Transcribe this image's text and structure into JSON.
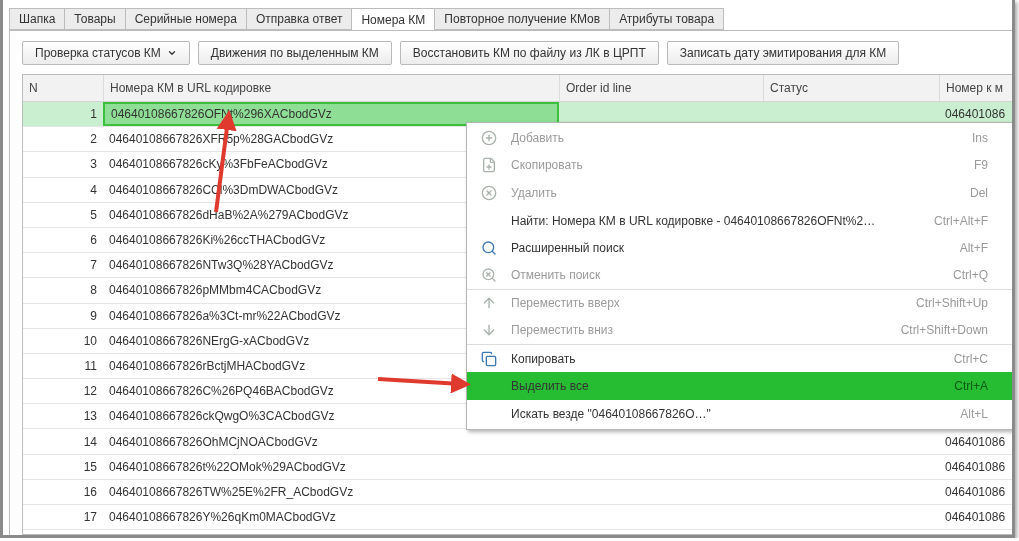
{
  "tabs": [
    {
      "label": "Шапка",
      "selected": false
    },
    {
      "label": "Товары",
      "selected": false
    },
    {
      "label": "Серийные номера",
      "selected": false
    },
    {
      "label": "Отправка ответ",
      "selected": false
    },
    {
      "label": "Номера КМ",
      "selected": true
    },
    {
      "label": "Повторное получение КМов",
      "selected": false
    },
    {
      "label": "Атрибуты товара",
      "selected": false
    }
  ],
  "toolbar": [
    {
      "label": "Проверка статусов КМ",
      "kind": "dropdown"
    },
    {
      "label": "Движения по выделенным КМ",
      "kind": "plain"
    },
    {
      "label": "Восстановить КМ по файлу из ЛК в ЦРПТ",
      "kind": "plain"
    },
    {
      "label": "Записать дату эмитирования для КМ",
      "kind": "plain"
    }
  ],
  "table": {
    "columns": [
      "N",
      "Номера КМ в URL кодировке",
      "Order id line",
      "Статус",
      "Номер к м"
    ],
    "rows": [
      {
        "n": "1",
        "code": "04640108667826OFNt%296XACbodGVz",
        "column_5": "046401086",
        "selected": true
      },
      {
        "n": "2",
        "code": "04640108667826XFR5p%28GACbodGVz",
        "selected": false
      },
      {
        "n": "3",
        "code": "04640108667826cKy%3FbFeACbodGVz",
        "selected": false
      },
      {
        "n": "4",
        "code": "04640108667826CCl%3DmDWACbodGVz",
        "selected": false
      },
      {
        "n": "5",
        "code": "04640108667826dHaB%2A%279ACbodGVz",
        "selected": false
      },
      {
        "n": "6",
        "code": "04640108667826Ki%26ccTHACbodGVz",
        "selected": false
      },
      {
        "n": "7",
        "code": "04640108667826NTw3Q%28YACbodGVz",
        "selected": false
      },
      {
        "n": "8",
        "code": "04640108667826pMMbm4CACbodGVz",
        "selected": false
      },
      {
        "n": "9",
        "code": "04640108667826a%3Ct-mr%22ACbodGVz",
        "selected": false
      },
      {
        "n": "10",
        "code": "04640108667826NErgG-xACbodGVz",
        "selected": false
      },
      {
        "n": "11",
        "code": "04640108667826rBctjMHACbodGVz",
        "selected": false
      },
      {
        "n": "12",
        "code": "04640108667826C%26PQ46BACbodGVz",
        "selected": false
      },
      {
        "n": "13",
        "code": "04640108667826ckQwgO%3CACbodGVz",
        "selected": false
      },
      {
        "n": "14",
        "code": "04640108667826OhMCjNOACbodGVz",
        "column_5": "046401086",
        "selected": false
      },
      {
        "n": "15",
        "code": "04640108667826t%22OMok%29ACbodGVz",
        "column_5": "046401086",
        "selected": false
      },
      {
        "n": "16",
        "code": "04640108667826TW%25E%2FR_ACbodGVz",
        "column_5": "046401086",
        "selected": false
      },
      {
        "n": "17",
        "code": "04640108667826Y%26qKm0MACbodGVz",
        "column_5": "046401086",
        "selected": false
      }
    ]
  },
  "context_menu": [
    {
      "label": "Добавить",
      "shortcut": "Ins",
      "disabled": true,
      "selected": false
    },
    {
      "label": "Скопировать",
      "shortcut": "F9",
      "disabled": true,
      "selected": false
    },
    {
      "label": "Удалить",
      "shortcut": "Del",
      "disabled": true,
      "selected": false
    },
    {
      "label": "Найти: Номера КМ в URL кодировке - 04640108667826OFNt%2…",
      "shortcut": "Ctrl+Alt+F",
      "disabled": false,
      "selected": false
    },
    {
      "label": "Расширенный поиск",
      "shortcut": "Alt+F",
      "disabled": false,
      "selected": false
    },
    {
      "label": "Отменить поиск",
      "shortcut": "Ctrl+Q",
      "disabled": true,
      "selected": false,
      "separator_after": true
    },
    {
      "label": "Переместить вверх",
      "shortcut": "Ctrl+Shift+Up",
      "disabled": true,
      "selected": false
    },
    {
      "label": "Переместить вниз",
      "shortcut": "Ctrl+Shift+Down",
      "disabled": true,
      "selected": false,
      "separator_after": true
    },
    {
      "label": "Копировать",
      "shortcut": "Ctrl+C",
      "disabled": false,
      "selected": false
    },
    {
      "label": "Выделить все",
      "shortcut": "Ctrl+A",
      "disabled": false,
      "selected": true
    },
    {
      "label": "Искать везде \"04640108667826O…\"",
      "shortcut": "Alt+L",
      "disabled": false,
      "selected": false
    }
  ]
}
